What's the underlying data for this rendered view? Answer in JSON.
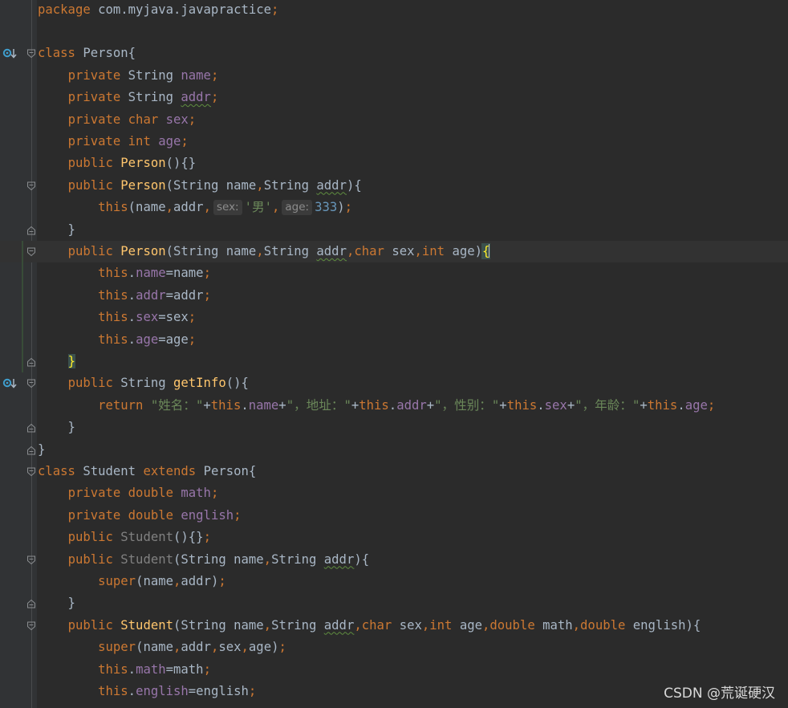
{
  "editor": {
    "lines": [
      [
        [
          "k",
          "package "
        ],
        [
          "t",
          "com.myjava.javapractice"
        ],
        [
          "p",
          ";"
        ]
      ],
      [],
      [
        [
          "k",
          "class "
        ],
        [
          "t",
          "Person{"
        ]
      ],
      [
        [
          "t",
          "    "
        ],
        [
          "k",
          "private "
        ],
        [
          "t",
          "String "
        ],
        [
          "f",
          "name"
        ],
        [
          "p",
          ";"
        ]
      ],
      [
        [
          "t",
          "    "
        ],
        [
          "k",
          "private "
        ],
        [
          "t",
          "String "
        ],
        [
          "fw",
          "addr"
        ],
        [
          "p",
          ";"
        ]
      ],
      [
        [
          "t",
          "    "
        ],
        [
          "k",
          "private char "
        ],
        [
          "f",
          "sex"
        ],
        [
          "p",
          ";"
        ]
      ],
      [
        [
          "t",
          "    "
        ],
        [
          "k",
          "private int "
        ],
        [
          "f",
          "age"
        ],
        [
          "p",
          ";"
        ]
      ],
      [
        [
          "t",
          "    "
        ],
        [
          "k",
          "public "
        ],
        [
          "m",
          "Person"
        ],
        [
          "t",
          "(){}"
        ]
      ],
      [
        [
          "t",
          "    "
        ],
        [
          "k",
          "public "
        ],
        [
          "m",
          "Person"
        ],
        [
          "t",
          "(String name"
        ],
        [
          "p",
          ","
        ],
        [
          "t",
          "String "
        ],
        [
          "tw",
          "addr"
        ],
        [
          "t",
          "){"
        ]
      ],
      [
        [
          "t",
          "        "
        ],
        [
          "k",
          "this"
        ],
        [
          "t",
          "(name"
        ],
        [
          "p",
          ","
        ],
        [
          "t",
          "addr"
        ],
        [
          "p",
          ","
        ],
        [
          "h",
          "sex:"
        ],
        [
          "s",
          "'男'"
        ],
        [
          "p",
          ","
        ],
        [
          "h",
          "age:"
        ],
        [
          "n",
          "333"
        ],
        [
          "t",
          ")"
        ],
        [
          "p",
          ";"
        ]
      ],
      [
        [
          "t",
          "    }"
        ]
      ],
      [
        [
          "t",
          "    "
        ],
        [
          "k",
          "public "
        ],
        [
          "m",
          "Person"
        ],
        [
          "t",
          "(String name"
        ],
        [
          "p",
          ","
        ],
        [
          "t",
          "String "
        ],
        [
          "tw",
          "addr"
        ],
        [
          "p",
          ","
        ],
        [
          "k",
          "char "
        ],
        [
          "t",
          "sex"
        ],
        [
          "p",
          ","
        ],
        [
          "k",
          "int "
        ],
        [
          "t",
          "age)"
        ],
        [
          "bo",
          "{"
        ]
      ],
      [
        [
          "t",
          "        "
        ],
        [
          "k",
          "this"
        ],
        [
          "t",
          "."
        ],
        [
          "f",
          "name"
        ],
        [
          "t",
          "=name"
        ],
        [
          "p",
          ";"
        ]
      ],
      [
        [
          "t",
          "        "
        ],
        [
          "k",
          "this"
        ],
        [
          "t",
          "."
        ],
        [
          "f",
          "addr"
        ],
        [
          "t",
          "=addr"
        ],
        [
          "p",
          ";"
        ]
      ],
      [
        [
          "t",
          "        "
        ],
        [
          "k",
          "this"
        ],
        [
          "t",
          "."
        ],
        [
          "f",
          "sex"
        ],
        [
          "t",
          "=sex"
        ],
        [
          "p",
          ";"
        ]
      ],
      [
        [
          "t",
          "        "
        ],
        [
          "k",
          "this"
        ],
        [
          "t",
          "."
        ],
        [
          "f",
          "age"
        ],
        [
          "t",
          "=age"
        ],
        [
          "p",
          ";"
        ]
      ],
      [
        [
          "t",
          "    "
        ],
        [
          "bc",
          "}"
        ]
      ],
      [
        [
          "t",
          "    "
        ],
        [
          "k",
          "public "
        ],
        [
          "t",
          "String "
        ],
        [
          "m",
          "getInfo"
        ],
        [
          "t",
          "(){"
        ]
      ],
      [
        [
          "t",
          "        "
        ],
        [
          "k",
          "return "
        ],
        [
          "s",
          "\"姓名：\""
        ],
        [
          "t",
          "+"
        ],
        [
          "k",
          "this"
        ],
        [
          "t",
          "."
        ],
        [
          "f",
          "name"
        ],
        [
          "t",
          "+"
        ],
        [
          "s",
          "\"，地址：\""
        ],
        [
          "t",
          "+"
        ],
        [
          "k",
          "this"
        ],
        [
          "t",
          "."
        ],
        [
          "f",
          "addr"
        ],
        [
          "t",
          "+"
        ],
        [
          "s",
          "\"，性别：\""
        ],
        [
          "t",
          "+"
        ],
        [
          "k",
          "this"
        ],
        [
          "t",
          "."
        ],
        [
          "f",
          "sex"
        ],
        [
          "t",
          "+"
        ],
        [
          "s",
          "\"，年龄：\""
        ],
        [
          "t",
          "+"
        ],
        [
          "k",
          "this"
        ],
        [
          "t",
          "."
        ],
        [
          "f",
          "age"
        ],
        [
          "p",
          ";"
        ]
      ],
      [
        [
          "t",
          "    }"
        ]
      ],
      [
        [
          "t",
          "}"
        ]
      ],
      [
        [
          "k",
          "class "
        ],
        [
          "t",
          "Student "
        ],
        [
          "k",
          "extends "
        ],
        [
          "t",
          "Person{"
        ]
      ],
      [
        [
          "t",
          "    "
        ],
        [
          "k",
          "private double "
        ],
        [
          "f",
          "math"
        ],
        [
          "p",
          ";"
        ]
      ],
      [
        [
          "t",
          "    "
        ],
        [
          "k",
          "private double "
        ],
        [
          "f",
          "english"
        ],
        [
          "p",
          ";"
        ]
      ],
      [
        [
          "t",
          "    "
        ],
        [
          "k",
          "public "
        ],
        [
          "g",
          "Student"
        ],
        [
          "t",
          "(){}"
        ],
        [
          "p",
          ";"
        ]
      ],
      [
        [
          "t",
          "    "
        ],
        [
          "k",
          "public "
        ],
        [
          "g",
          "Student"
        ],
        [
          "t",
          "(String name"
        ],
        [
          "p",
          ","
        ],
        [
          "t",
          "String "
        ],
        [
          "tw",
          "addr"
        ],
        [
          "t",
          "){"
        ]
      ],
      [
        [
          "t",
          "        "
        ],
        [
          "k",
          "super"
        ],
        [
          "t",
          "(name"
        ],
        [
          "p",
          ","
        ],
        [
          "t",
          "addr)"
        ],
        [
          "p",
          ";"
        ]
      ],
      [
        [
          "t",
          "    }"
        ]
      ],
      [
        [
          "t",
          "    "
        ],
        [
          "k",
          "public "
        ],
        [
          "m",
          "Student"
        ],
        [
          "t",
          "(String name"
        ],
        [
          "p",
          ","
        ],
        [
          "t",
          "String "
        ],
        [
          "tw",
          "addr"
        ],
        [
          "p",
          ","
        ],
        [
          "k",
          "char "
        ],
        [
          "t",
          "sex"
        ],
        [
          "p",
          ","
        ],
        [
          "k",
          "int "
        ],
        [
          "t",
          "age"
        ],
        [
          "p",
          ","
        ],
        [
          "k",
          "double "
        ],
        [
          "t",
          "math"
        ],
        [
          "p",
          ","
        ],
        [
          "k",
          "double "
        ],
        [
          "t",
          "english){"
        ]
      ],
      [
        [
          "t",
          "        "
        ],
        [
          "k",
          "super"
        ],
        [
          "t",
          "(name"
        ],
        [
          "p",
          ","
        ],
        [
          "t",
          "addr"
        ],
        [
          "p",
          ","
        ],
        [
          "t",
          "sex"
        ],
        [
          "p",
          ","
        ],
        [
          "t",
          "age)"
        ],
        [
          "p",
          ";"
        ]
      ],
      [
        [
          "t",
          "        "
        ],
        [
          "k",
          "this"
        ],
        [
          "t",
          "."
        ],
        [
          "f",
          "math"
        ],
        [
          "t",
          "=math"
        ],
        [
          "p",
          ";"
        ]
      ],
      [
        [
          "t",
          "        "
        ],
        [
          "k",
          "this"
        ],
        [
          "t",
          "."
        ],
        [
          "f",
          "english"
        ],
        [
          "t",
          "=english"
        ],
        [
          "p",
          ";"
        ]
      ]
    ]
  },
  "watermark": "CSDN @荒诞硬汉",
  "colors": {
    "background": "#2b2b2b",
    "gutter": "#313335",
    "keyword": "#cc7832",
    "field": "#9876aa",
    "method": "#ffc66d",
    "string": "#6a8759",
    "number": "#6897bb",
    "text": "#a9b7c6"
  },
  "gutter_icons": [
    "override-method-icon",
    "override-method-icon"
  ]
}
